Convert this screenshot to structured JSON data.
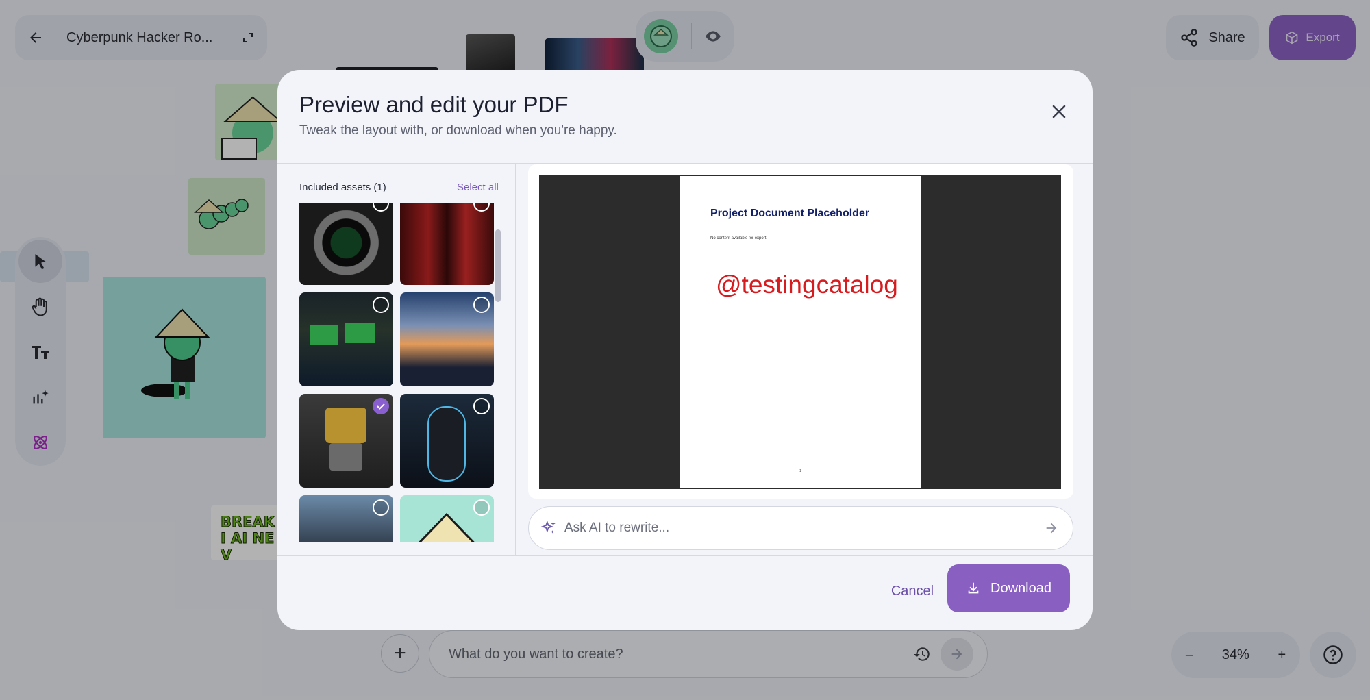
{
  "background": {
    "project_title": "Cyberpunk Hacker Ro...",
    "share_label": "Share",
    "export_label": "Export",
    "prompt_placeholder": "What do you want to create?",
    "zoom_level": "34%",
    "thumb_text": "BREAKI AI NEV"
  },
  "modal": {
    "title": "Preview and edit your PDF",
    "subtitle": "Tweak the layout with, or download when you're happy.",
    "assets_label": "Included assets (1)",
    "select_all_label": "Select all",
    "assets": [
      {
        "name": "hacker-terminal-lens",
        "selected": false
      },
      {
        "name": "red-alley",
        "selected": false
      },
      {
        "name": "hacker-room",
        "selected": false
      },
      {
        "name": "city-skyline",
        "selected": false
      },
      {
        "name": "yellow-robot",
        "selected": true
      },
      {
        "name": "neon-armor",
        "selected": false
      },
      {
        "name": "mech-city",
        "selected": false
      },
      {
        "name": "conical-hat-character",
        "selected": false
      }
    ],
    "pdf": {
      "title": "Project Document Placeholder",
      "note": "No content available for export.",
      "watermark": "@testingcatalog",
      "page_number": "1"
    },
    "ai_placeholder": "Ask AI to rewrite...",
    "cancel_label": "Cancel",
    "download_label": "Download"
  },
  "colors": {
    "accent": "#8a5fc2",
    "watermark": "#d71c20",
    "pdf_title": "#13206a"
  }
}
